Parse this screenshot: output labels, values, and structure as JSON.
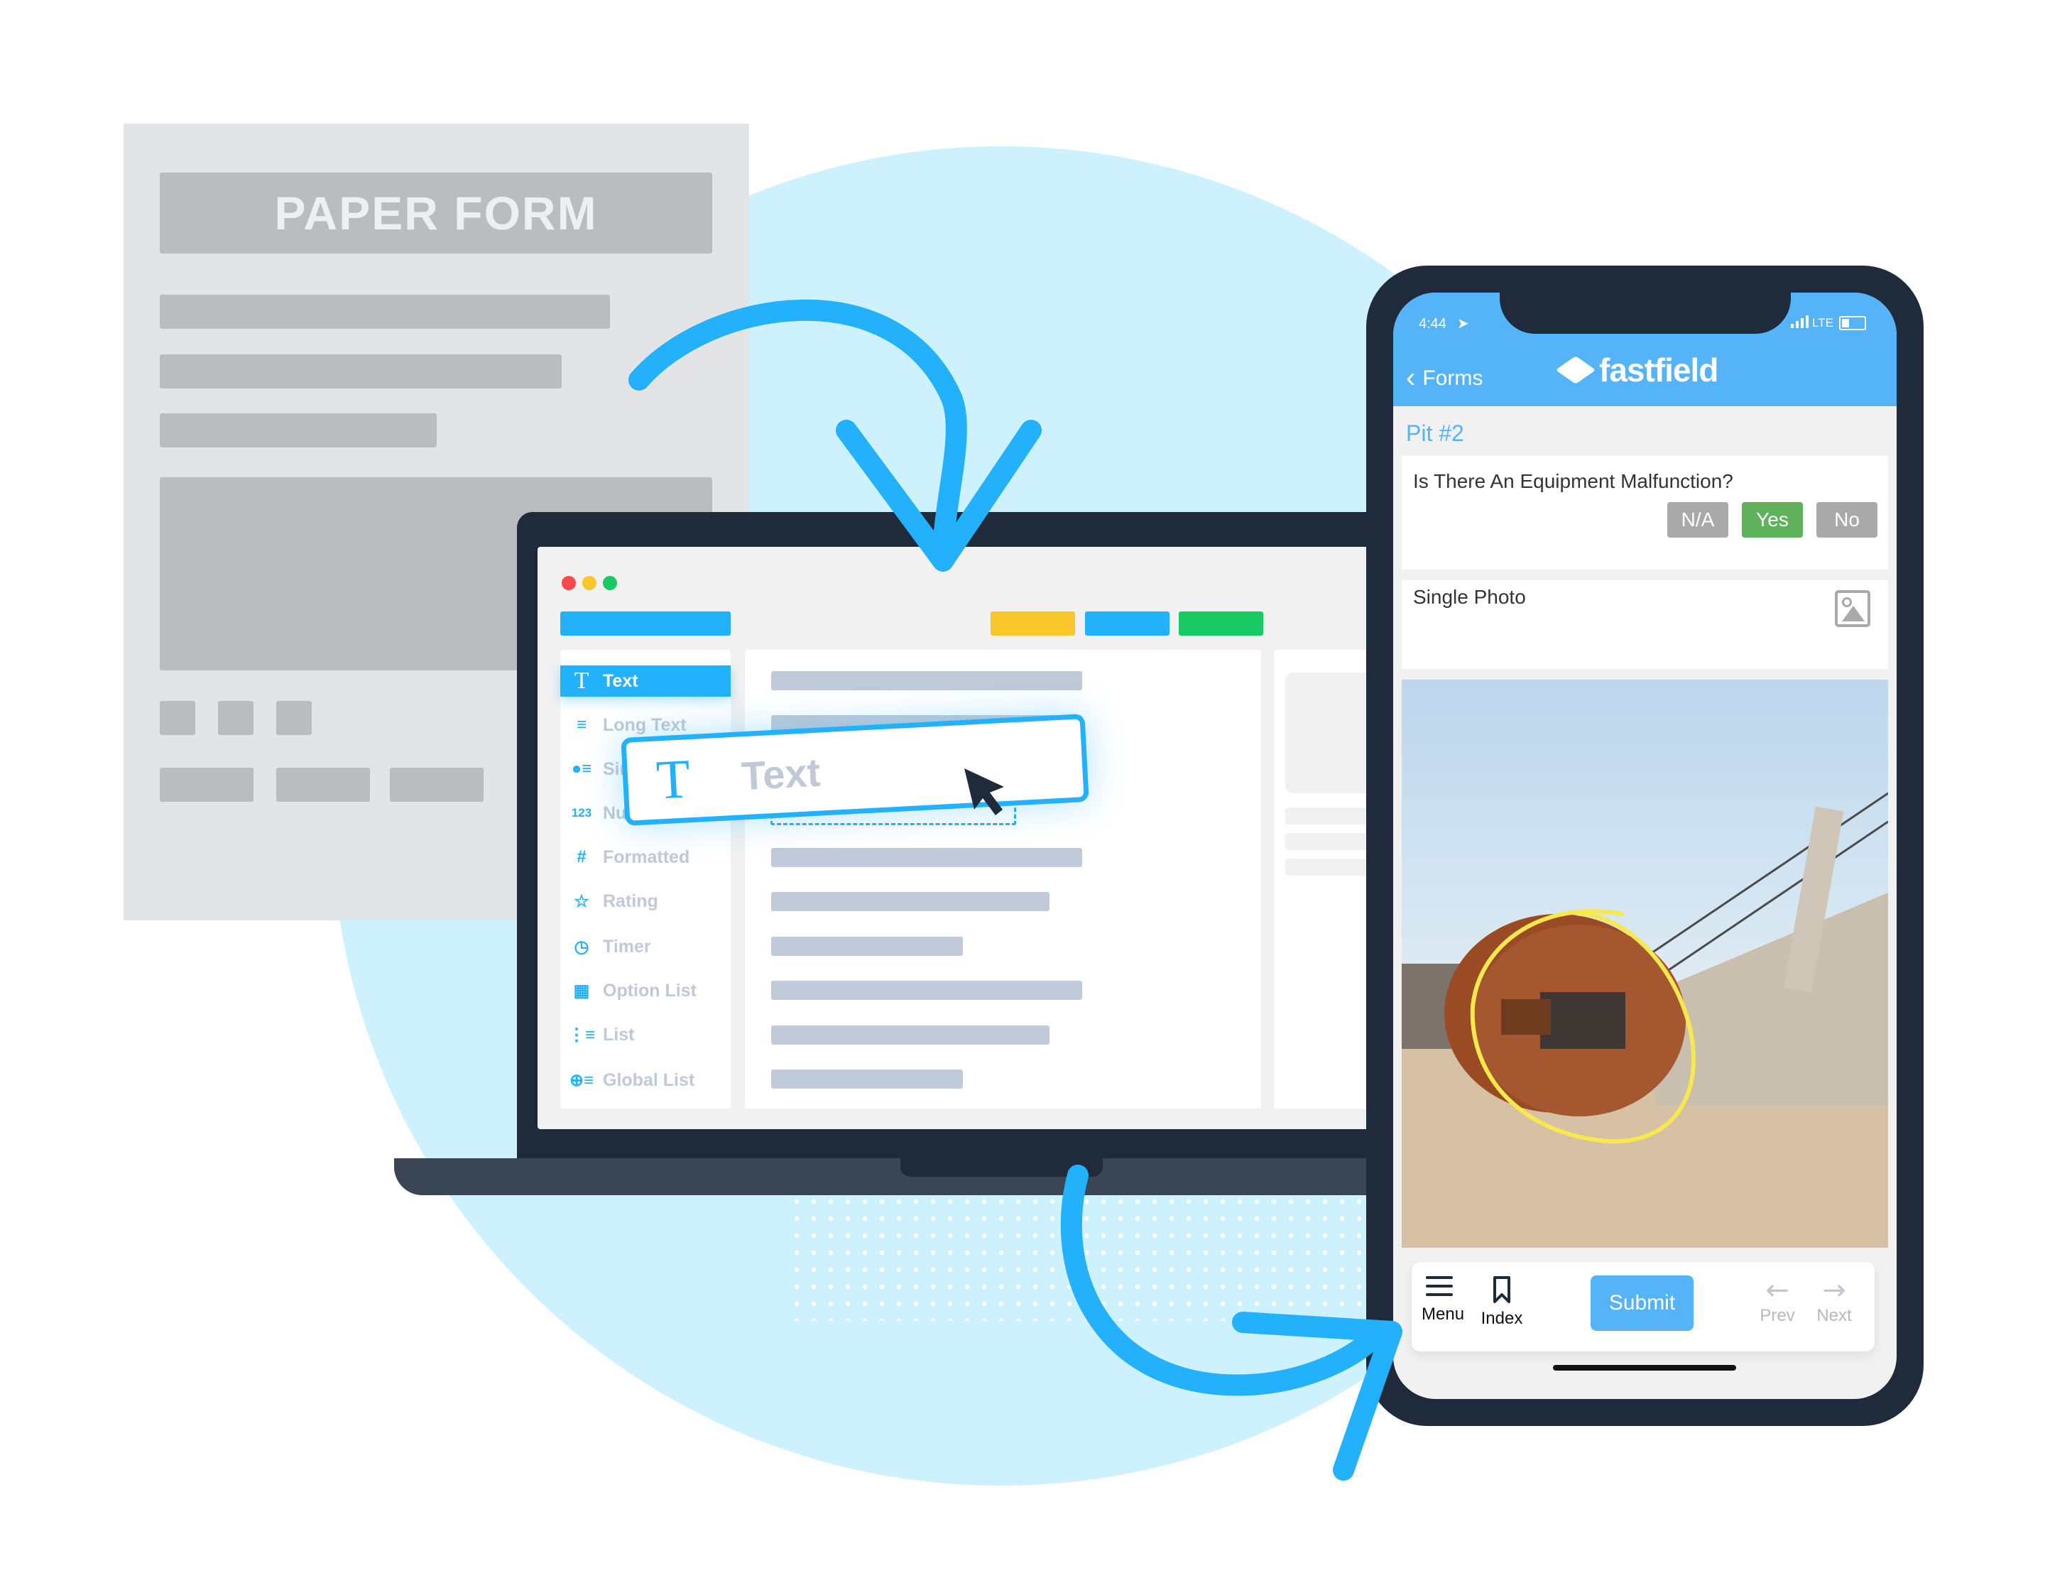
{
  "paper_form": {
    "title": "PAPER FORM"
  },
  "colors": {
    "accent_blue": "#23b1fb",
    "phone_blue": "#55b4f8",
    "yes_green": "#5fb15b",
    "neutral_gray": "#a9a9a9",
    "bezel_dark": "#1f2a3b",
    "circle_bg": "#cdf1fd",
    "annotation_yellow": "#f6e84d"
  },
  "builder": {
    "window_dots": [
      "#f84a4a",
      "#fbc52c",
      "#18c964"
    ],
    "toolbar_buttons": [
      {
        "name": "yellow-action",
        "color": "#fbc52c"
      },
      {
        "name": "blue-action",
        "color": "#23b1fb"
      },
      {
        "name": "green-action",
        "color": "#18c964"
      }
    ],
    "sidebar_items": [
      {
        "label": "Text",
        "icon": "T",
        "active": true
      },
      {
        "label": "Long Text",
        "icon": "≡",
        "active": false
      },
      {
        "label": "Single Choice",
        "icon": "●≡",
        "active": false
      },
      {
        "label": "Numeric",
        "icon": "123",
        "active": false
      },
      {
        "label": "Formatted",
        "icon": "#",
        "active": false
      },
      {
        "label": "Rating",
        "icon": "☆",
        "active": false
      },
      {
        "label": "Timer",
        "icon": "◷",
        "active": false
      },
      {
        "label": "Option List",
        "icon": "▦",
        "active": false
      },
      {
        "label": "List",
        "icon": "⋮≡",
        "active": false
      },
      {
        "label": "Global List",
        "icon": "⊕≡",
        "active": false
      }
    ],
    "drag_card": {
      "icon": "T",
      "label": "Text"
    }
  },
  "phone": {
    "status": {
      "time": "4:44",
      "network": "LTE"
    },
    "header": {
      "back_label": "Forms",
      "brand": "fastfield"
    },
    "section_title": "Pit #2",
    "question": {
      "label": "Is There An Equipment Malfunction?",
      "options": [
        "N/A",
        "Yes",
        "No"
      ],
      "selected": "Yes"
    },
    "photo_field": {
      "label": "Single Photo"
    },
    "bottom_bar": {
      "menu_label": "Menu",
      "index_label": "Index",
      "submit_label": "Submit",
      "prev_label": "Prev",
      "next_label": "Next"
    }
  }
}
